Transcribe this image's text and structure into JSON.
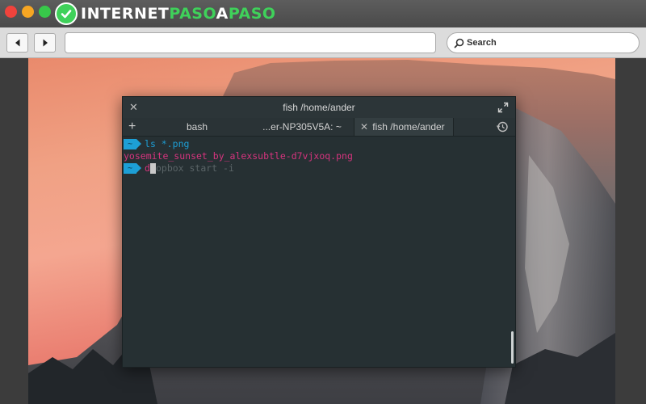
{
  "logo": {
    "part1": "INTERNET",
    "part2": "PASO",
    "part3": "A",
    "part4": "PASO"
  },
  "browser": {
    "search_label": "Search"
  },
  "terminal": {
    "title": "fish  /home/ander",
    "tabs": [
      {
        "label": "bash"
      },
      {
        "label": "...er-NP305V5A: ~"
      },
      {
        "label": "fish  /home/ander"
      }
    ],
    "prompt_symbol": "~",
    "lines": {
      "cmd1": "ls *.png",
      "output1": "yosemite_sunset_by_alexsubtle-d7vjxoq.png",
      "typed": "d",
      "suggestion": "opbox start -i"
    }
  },
  "colors": {
    "prompt_bg": "#1d9fd6",
    "output_text": "#d6347e",
    "terminal_bg": "#263033",
    "logo_green": "#3fd15a"
  },
  "icons": {
    "close": "close-icon",
    "maximize": "maximize-icon",
    "add_tab": "plus-icon",
    "history": "history-icon",
    "back": "back-arrow-icon",
    "forward": "forward-arrow-icon",
    "search": "search-icon"
  }
}
